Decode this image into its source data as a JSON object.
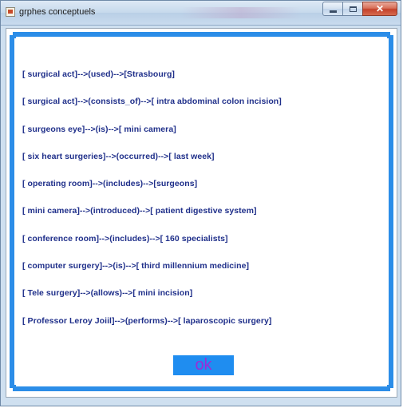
{
  "window": {
    "title": "grphes conceptuels",
    "controls": {
      "minimize": "",
      "maximize": "",
      "close": "✕"
    }
  },
  "graphs": [
    "[ surgical act]-->(used)-->[Strasbourg]",
    "[ surgical act]-->(consists_of)-->[ intra abdominal colon incision]",
    "[ surgeons eye]-->(is)-->[ mini camera]",
    "[ six heart surgeries]-->(occurred)-->[ last week]",
    "[ operating room]-->(includes)-->[surgeons]",
    "[ mini camera]-->(introduced)-->[ patient digestive system]",
    "[ conference room]-->(includes)-->[ 160 specialists]",
    "[ computer surgery]-->(is)-->[ third millennium medicine]",
    "[ Tele surgery]-->(allows)-->[ mini incision]",
    "[ Professor Leroy Joiil]-->(performs)-->[ laparoscopic surgery]"
  ],
  "ok_button": {
    "label": "ok"
  },
  "colors": {
    "frame": "#2b8de8",
    "text": "#1f2f8a",
    "button_bg": "#1f8df0",
    "button_text": "#9b2cd6"
  }
}
